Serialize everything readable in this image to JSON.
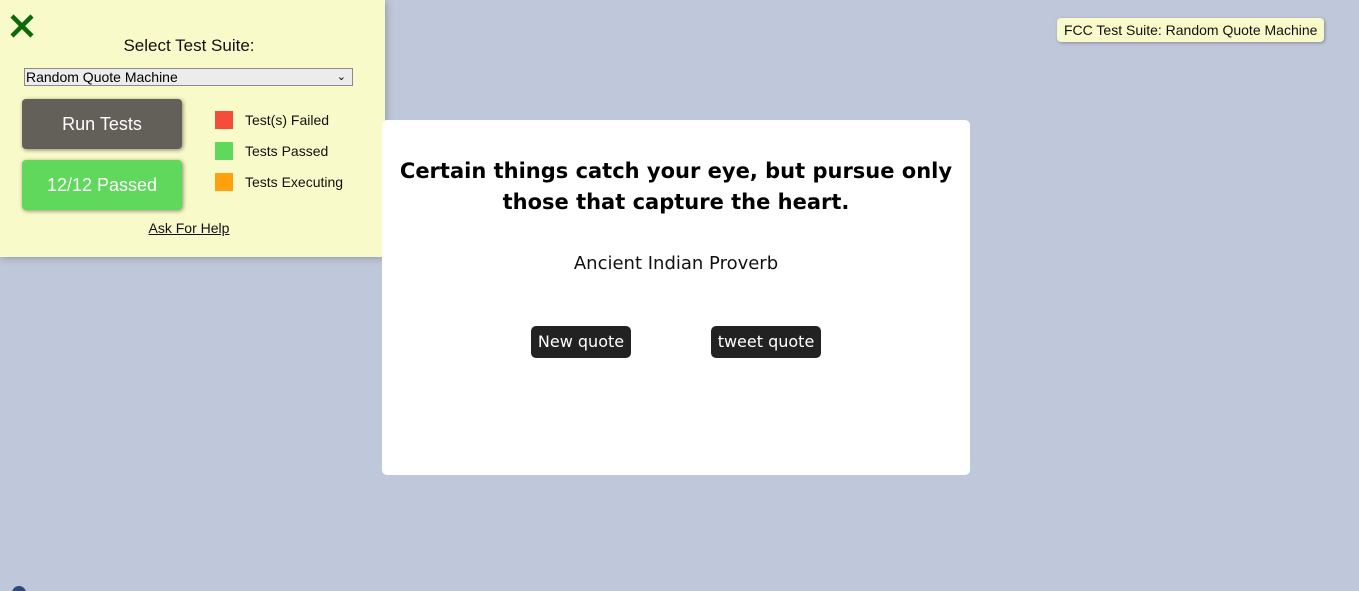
{
  "fcc_panel": {
    "close_icon": "close-x-icon",
    "title": "Select Test Suite:",
    "selected_suite": "Random Quote Machine",
    "run_button": "Run Tests",
    "status_button": "12/12 Passed",
    "legend": [
      {
        "label": "Test(s) Failed",
        "color": "#f44e3b"
      },
      {
        "label": "Tests Passed",
        "color": "#5fd85c"
      },
      {
        "label": "Tests Executing",
        "color": "#ffa10c"
      }
    ],
    "help_link": "Ask For Help"
  },
  "badge": {
    "text": "FCC Test Suite: Random Quote Machine"
  },
  "quote": {
    "text": "Certain things catch your eye, but pursue only those that capture the heart.",
    "author": "Ancient Indian Proverb",
    "new_button": "New quote",
    "tweet_button": "tweet quote"
  },
  "colors": {
    "background": "#bfc7da",
    "panel": "#f9fac9",
    "run_button": "#63605a",
    "passed_button": "#5fd85c",
    "quote_button": "#222222"
  }
}
